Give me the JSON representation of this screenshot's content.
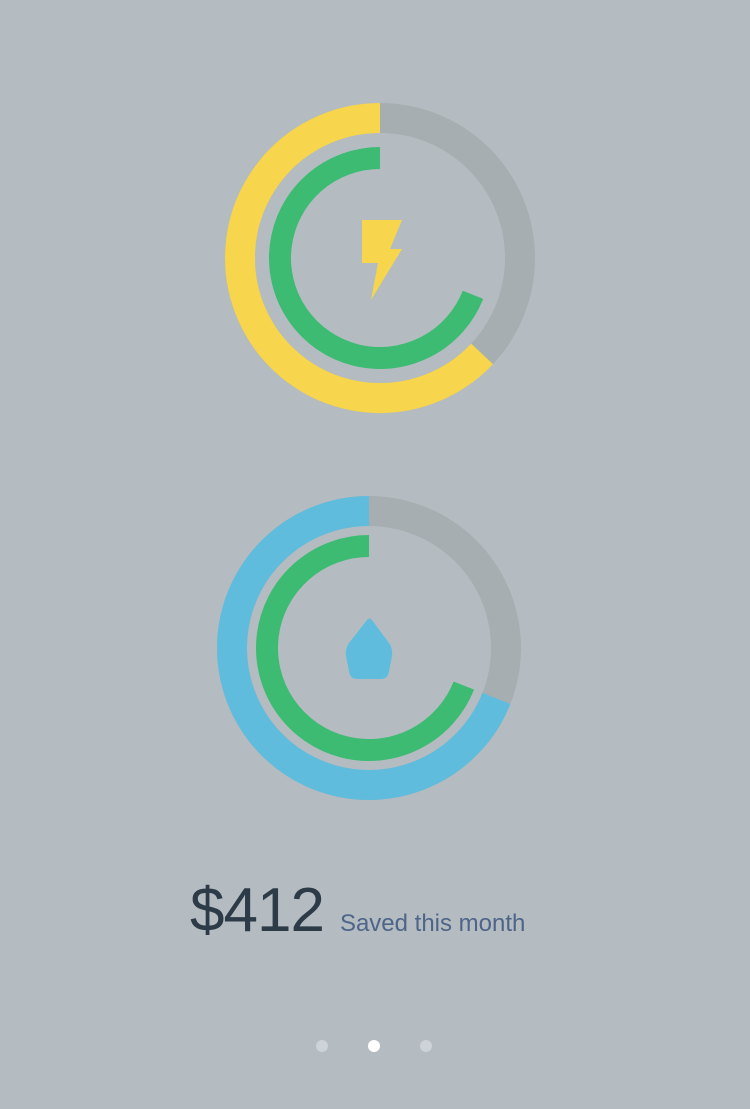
{
  "gauges": [
    {
      "id": "electricity",
      "icon": "lightning-bolt-icon",
      "outer_progress": 0.63,
      "inner_progress": 0.69,
      "outer_color": "#f7d54c",
      "inner_color": "#3dbb73",
      "track_color": "#a6aeb1",
      "icon_color": "#f7d54c"
    },
    {
      "id": "water",
      "icon": "water-drop-icon",
      "outer_progress": 0.69,
      "inner_progress": 0.69,
      "outer_color": "#60bcdd",
      "inner_color": "#3dbb73",
      "track_color": "#a6aeb1",
      "icon_color": "#60bcdd"
    }
  ],
  "savings": {
    "amount": "$412",
    "label": "Saved this month"
  },
  "pager": {
    "count": 3,
    "active_index": 1
  },
  "colors": {
    "background": "#b4bcc1",
    "amount_text": "#2d3a47",
    "label_text": "#4e6589",
    "dot_inactive": "#cdd3d8",
    "dot_active": "#ffffff"
  }
}
